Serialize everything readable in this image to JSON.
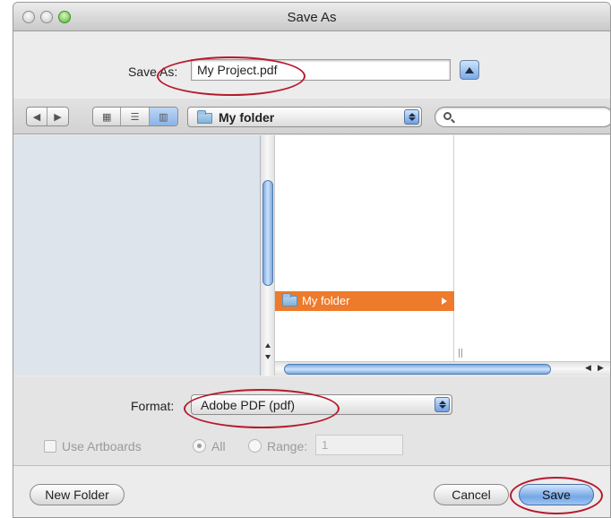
{
  "window": {
    "title": "Save As"
  },
  "save_as": {
    "label": "Save As:",
    "value": "My Project.pdf"
  },
  "toolbar": {
    "location": {
      "label": "My folder"
    },
    "search": {
      "placeholder": ""
    }
  },
  "browser": {
    "selected_folder": "My folder"
  },
  "options": {
    "format_label": "Format:",
    "format_value": "Adobe PDF (pdf)",
    "use_artboards_label": "Use Artboards",
    "all_label": "All",
    "range_label": "Range:",
    "range_value": "1"
  },
  "buttons": {
    "new_folder": "New Folder",
    "cancel": "Cancel",
    "save": "Save"
  },
  "highlight_color": "#b51a2e",
  "selection_color": "#ee7a2b"
}
